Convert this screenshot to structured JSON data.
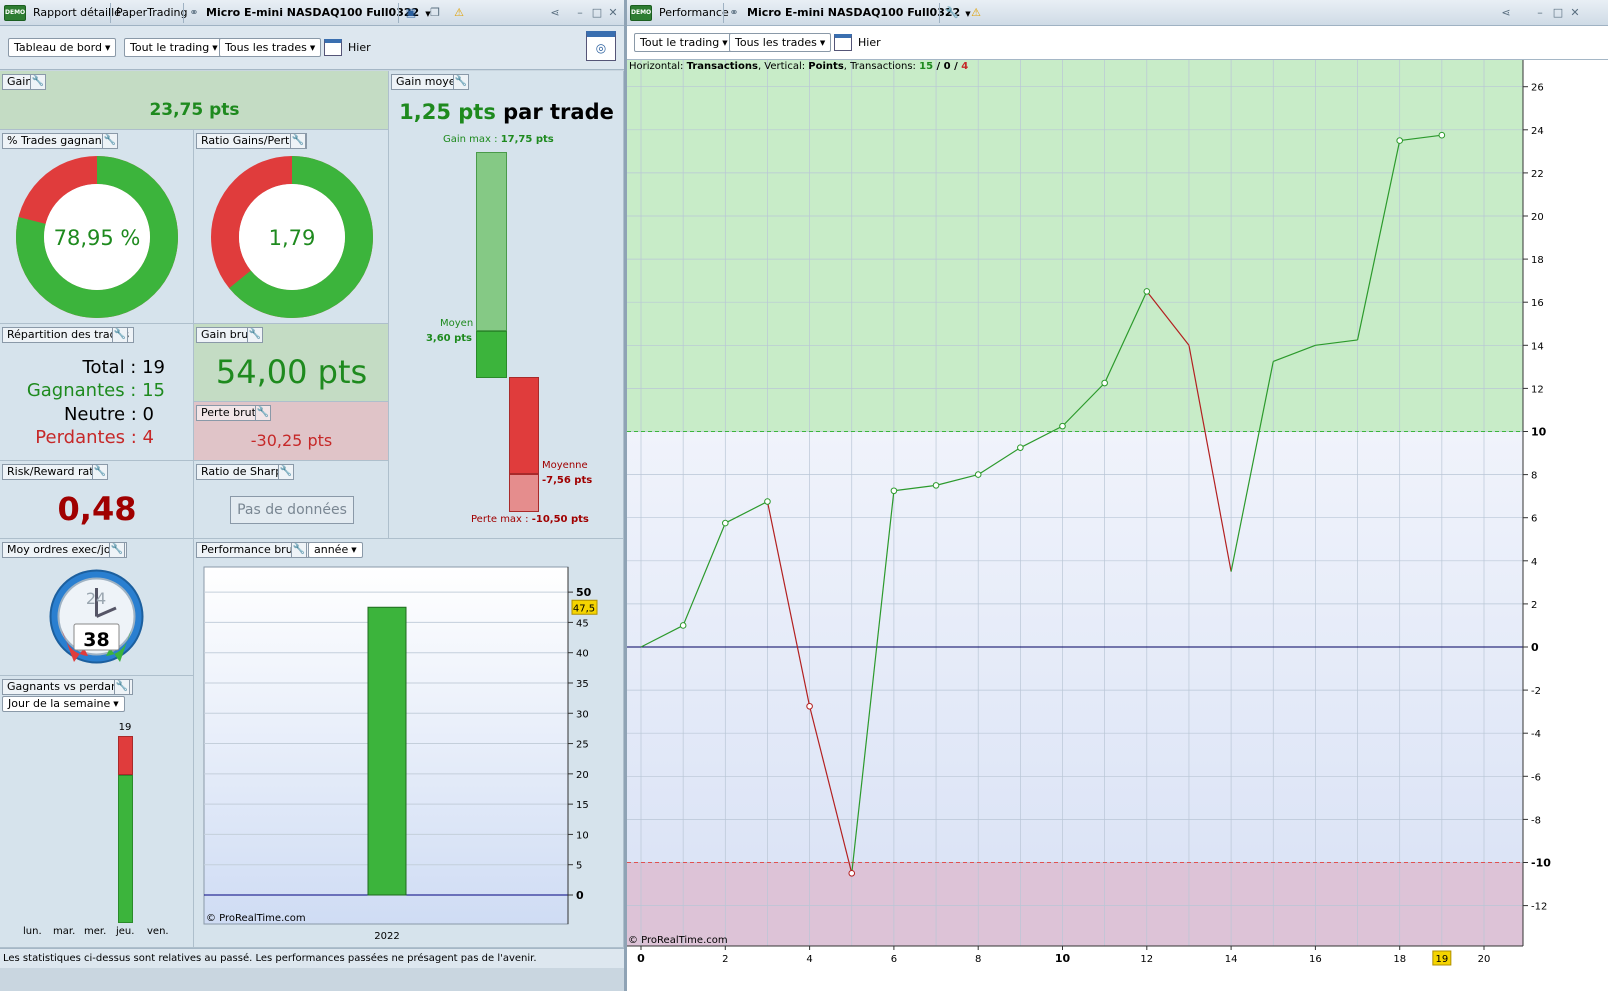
{
  "left_titlebar": {
    "demo": "DEMO",
    "tab1": "Rapport détaillé",
    "tab2": "PaperTrading",
    "instrument": "Micro E-mini NASDAQ100 Full0322"
  },
  "right_titlebar": {
    "demo": "DEMO",
    "title": "Performance",
    "instrument": "Micro E-mini NASDAQ100 Full0322"
  },
  "left_toolbar": {
    "dashboard": "Tableau de bord",
    "trading": "Tout le trading",
    "trades": "Tous les trades",
    "date": "Hier"
  },
  "right_toolbar": {
    "trading": "Tout le trading",
    "trades": "Tous les trades",
    "date": "Hier"
  },
  "gain": {
    "title": "Gain",
    "value": "23,75 pts"
  },
  "win_pct": {
    "title": "% Trades gagnants",
    "value": "78,95 %",
    "fraction": 0.7895
  },
  "ratio": {
    "title": "Ratio Gains/Pertes",
    "value": "1,79",
    "fraction": 0.641
  },
  "avg_gain": {
    "title": "Gain moyen",
    "value": "1,25 pts",
    "suffix": "par trade",
    "max_gain_label": "Gain max :",
    "max_gain": "17,75 pts",
    "mean_label": "Moyen",
    "mean": "3,60 pts",
    "mean_loss_label": "Moyenne",
    "mean_loss": "-7,56 pts",
    "max_loss_label": "Perte max :",
    "max_loss": "-10,50 pts"
  },
  "distribution": {
    "title": "Répartition des trades",
    "total": "Total : 19",
    "winners": "Gagnantes : 15",
    "neutral": "Neutre : 0",
    "losers": "Perdantes : 4"
  },
  "gross_gain": {
    "title": "Gain brut",
    "value": "54,00 pts"
  },
  "gross_loss": {
    "title": "Perte brute",
    "value": "-30,25 pts"
  },
  "risk_reward": {
    "title": "Risk/Reward ratio",
    "value": "0,48"
  },
  "sharpe": {
    "title": "Ratio de Sharpe",
    "value": "Pas de données"
  },
  "orders": {
    "title": "Moy ordres exec/jour",
    "clock_hours": "24",
    "value": "38"
  },
  "gross_perf": {
    "title": "Performance brute",
    "period": "année",
    "copyright": "© ProRealTime.com"
  },
  "winners_losers": {
    "title": "Gagnants vs perdants",
    "period": "Jour de la semaine",
    "days": [
      "lun.",
      "mar.",
      "mer.",
      "jeu.",
      "ven."
    ],
    "count_label": "19"
  },
  "footer": "Les statistiques ci-dessus sont relatives au passé. Les performances passées ne présagent pas de l'avenir.",
  "perf_chart": {
    "info_h": "Horizontal:",
    "info_h_val": "Transactions",
    "info_v": ", Vertical:",
    "info_v_val": "Points",
    "info_t": ", Transactions:",
    "info_win": "15",
    "info_slash1": " / ",
    "info_neutral": "0",
    "info_slash2": " / ",
    "info_loss": "4",
    "copyright": "© ProRealTime.com"
  },
  "colors": {
    "green": "#3cb43c",
    "red": "#e03c3c",
    "dark_green": "#1e8a1e",
    "dark_red": "#a00000"
  },
  "chart_data": [
    {
      "type": "line",
      "x": [
        0,
        1,
        2,
        3,
        4,
        5,
        6,
        7,
        8,
        9,
        10,
        11,
        12,
        13,
        14,
        15,
        16,
        17,
        18,
        19
      ],
      "y": [
        0,
        1,
        5.75,
        6.75,
        -2.75,
        -10.5,
        7.25,
        7.5,
        8,
        9.25,
        10.25,
        12.25,
        16.5,
        14,
        3.5,
        13.25,
        14,
        14.25,
        23.5,
        23.75
      ],
      "xlim": [
        0,
        21
      ],
      "ylim": [
        -13.5,
        27
      ],
      "x_ticks": [
        0,
        2,
        4,
        6,
        8,
        10,
        12,
        14,
        16,
        18,
        20
      ],
      "y_ticks": [
        -12,
        -10,
        -8,
        -6,
        -4,
        -2,
        0,
        2,
        4,
        6,
        8,
        10,
        12,
        14,
        16,
        18,
        20,
        22,
        24,
        26
      ],
      "x_highlight": "19",
      "upper_threshold": 10,
      "lower_threshold": -10,
      "xlabel": "Transactions",
      "ylabel": "Points"
    },
    {
      "type": "bar",
      "categories": [
        "2022"
      ],
      "values": [
        47.5
      ],
      "value_label": "47,5",
      "ylim": [
        0,
        52
      ],
      "y_ticks": [
        0,
        5,
        10,
        15,
        20,
        25,
        30,
        35,
        40,
        45,
        50
      ]
    },
    {
      "type": "bar",
      "categories": [
        "jeu."
      ],
      "series": [
        {
          "values": [
            15
          ]
        },
        {
          "values": [
            4
          ]
        }
      ],
      "total": 19
    }
  ]
}
